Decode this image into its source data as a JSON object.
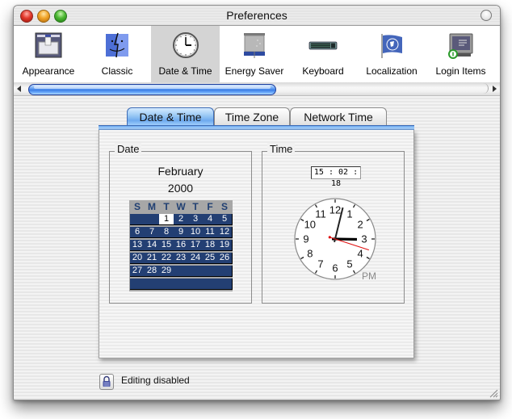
{
  "window": {
    "title": "Preferences"
  },
  "toolbar": {
    "items": [
      {
        "label": "Appearance",
        "icon": "appearance-icon"
      },
      {
        "label": "Classic",
        "icon": "finder-face-icon"
      },
      {
        "label": "Date & Time",
        "icon": "clock-icon",
        "selected": true
      },
      {
        "label": "Energy Saver",
        "icon": "energy-saver-icon"
      },
      {
        "label": "Keyboard",
        "icon": "keyboard-icon"
      },
      {
        "label": "Localization",
        "icon": "flag-icon"
      },
      {
        "label": "Login Items",
        "icon": "login-monitor-icon"
      }
    ],
    "scroll_position": 0.0,
    "scroll_visible_fraction": 0.52
  },
  "tabs": [
    {
      "label": "Date & Time",
      "active": true
    },
    {
      "label": "Time Zone",
      "active": false
    },
    {
      "label": "Network Time",
      "active": false
    }
  ],
  "date_group": {
    "label": "Date",
    "month": "February",
    "year": "2000",
    "weekdays": [
      "S",
      "M",
      "T",
      "W",
      "T",
      "F",
      "S"
    ],
    "weeks": [
      [
        "",
        "",
        "1",
        "2",
        "3",
        "4",
        "5"
      ],
      [
        "6",
        "7",
        "8",
        "9",
        "10",
        "11",
        "12"
      ],
      [
        "13",
        "14",
        "15",
        "16",
        "17",
        "18",
        "19"
      ],
      [
        "20",
        "21",
        "22",
        "23",
        "24",
        "25",
        "26"
      ],
      [
        "27",
        "28",
        "29",
        "",
        "",
        "",
        ""
      ],
      [
        "",
        "",
        "",
        "",
        "",
        "",
        ""
      ]
    ],
    "selected_day": "1"
  },
  "time_group": {
    "label": "Time",
    "time_value": "15 : 02 : 18",
    "clock": {
      "hour": 15,
      "minute": 2,
      "second": 18,
      "numerals": [
        "12",
        "1",
        "2",
        "3",
        "4",
        "5",
        "6",
        "7",
        "8",
        "9",
        "10",
        "11"
      ],
      "meridiem": "PM"
    }
  },
  "footer": {
    "lock_label": "Editing disabled"
  },
  "colors": {
    "selected_tab": "#8cc0f2",
    "calendar_row": "#233f73",
    "calendar_header_text": "#203f72",
    "second_hand": "#e01010"
  }
}
